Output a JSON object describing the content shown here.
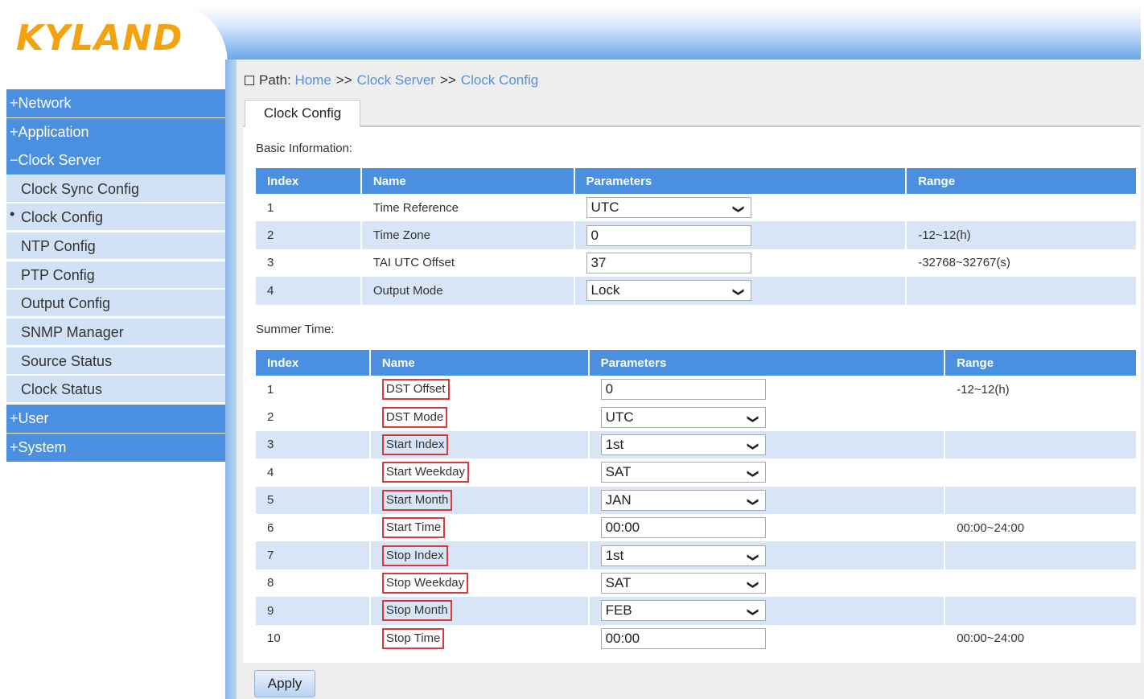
{
  "brand": {
    "logo": "KYLAND"
  },
  "sidebar": {
    "categories": {
      "network": "+Network",
      "application": "+Application",
      "clock_server": "−Clock Server",
      "user": "+User",
      "system": "+System"
    },
    "items": [
      "Clock Sync Config",
      "Clock Config",
      "NTP Config",
      "PTP Config",
      "Output Config",
      "SNMP Manager",
      "Source Status",
      "Clock Status"
    ],
    "active_marker": "•"
  },
  "breadcrumb": {
    "prefix": "Path:",
    "home": "Home",
    "sep": ">>",
    "level1": "Clock Server",
    "level2": "Clock Config"
  },
  "tab": {
    "label": "Clock Config"
  },
  "basic": {
    "title": "Basic Information:",
    "headers": {
      "index": "Index",
      "name": "Name",
      "parameters": "Parameters",
      "range": "Range"
    },
    "rows": [
      {
        "index": "1",
        "name": "Time Reference",
        "value": "UTC",
        "range": ""
      },
      {
        "index": "2",
        "name": "Time Zone",
        "value": "0",
        "range": "-12~12(h)"
      },
      {
        "index": "3",
        "name": "TAI UTC Offset",
        "value": "37",
        "range": "-32768~32767(s)"
      },
      {
        "index": "4",
        "name": "Output Mode",
        "value": "Lock",
        "range": ""
      }
    ]
  },
  "summer": {
    "title": "Summer Time:",
    "headers": {
      "index": "Index",
      "name": "Name",
      "parameters": "Parameters",
      "range": "Range"
    },
    "rows": [
      {
        "index": "1",
        "name": "DST Offset",
        "value": "0",
        "range": "-12~12(h)"
      },
      {
        "index": "2",
        "name": "DST Mode",
        "value": "UTC",
        "range": ""
      },
      {
        "index": "3",
        "name": "Start Index",
        "value": "1st",
        "range": ""
      },
      {
        "index": "4",
        "name": "Start Weekday",
        "value": "SAT",
        "range": ""
      },
      {
        "index": "5",
        "name": "Start Month",
        "value": "JAN",
        "range": ""
      },
      {
        "index": "6",
        "name": "Start Time",
        "value": "00:00",
        "range": "00:00~24:00"
      },
      {
        "index": "7",
        "name": "Stop Index",
        "value": "1st",
        "range": ""
      },
      {
        "index": "8",
        "name": "Stop Weekday",
        "value": "SAT",
        "range": ""
      },
      {
        "index": "9",
        "name": "Stop Month",
        "value": "FEB",
        "range": ""
      },
      {
        "index": "10",
        "name": "Stop Time",
        "value": "00:00",
        "range": "00:00~24:00"
      }
    ]
  },
  "apply_label": "Apply",
  "icons": {
    "dropdown": "chevron-down-icon",
    "path": "square-icon"
  },
  "colors": {
    "accent": "#4a8fe0",
    "row_alt": "#d7e5f7",
    "highlight": "#d63b3b",
    "logo": "#f2a30f"
  }
}
